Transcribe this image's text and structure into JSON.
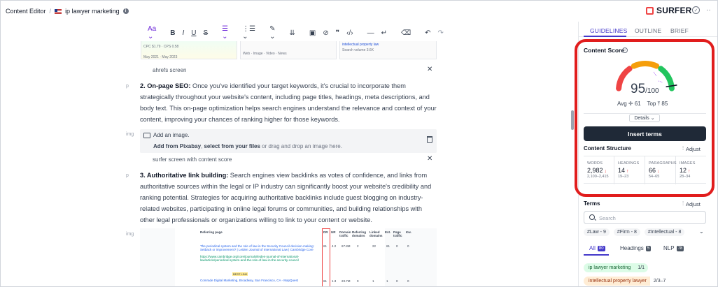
{
  "header": {
    "breadcrumb_root": "Content Editor",
    "breadcrumb_sep": "/",
    "document_name": "ip lawyer marketing",
    "brand": "SURFER"
  },
  "toolbar": {
    "font_label": "Aa"
  },
  "editor": {
    "card1_text": "CPC $1.79 · CPS 0.58",
    "card1_sub": "May 2021 · May 2023",
    "card2_text": "Web · Image · Video · News",
    "card3_link": "intellectual property law",
    "card3_text": "Search volume 3.6K",
    "caption_ahrefs": "ahrefs screen",
    "block_p": "p",
    "block_img": "img",
    "para2_bold": "2. On-page SEO:",
    "para2_text": " Once you've identified your target keywords, it's crucial to incorporate them strategically throughout your website's content, including page titles, headings, meta descriptions, and body text. This on-page optimization helps search engines understand the relevance and context of your content, improving your chances of ranking higher for those keywords.",
    "image_add": "Add an image.",
    "image_from_1": "Add from Pixabay",
    "image_from_2": ", ",
    "image_from_3": "select from your files",
    "image_from_4": " or drag and drop an image here.",
    "caption_surfer": "surfer screen with content score",
    "para3_bold": "3. Authoritative link building:",
    "para3_text": " Search engines view backlinks as votes of confidence, and links from authoritative sources within the legal or IP industry can significantly boost your website's credibility and ranking potential. Strategies for acquiring authoritative backlinks include guest blogging on industry-related websites, participating in online legal forums or communities, and building relationships with other legal professionals or organizations willing to link to your content or website.",
    "table_headers": [
      "Referring page",
      "DR",
      "UR",
      "Domain traffic",
      "Referring domains",
      "Linked domains",
      "Ext.",
      "Page traffic",
      "Kw."
    ],
    "table_row1_title": "The periodical system and the role of law in the Security Council decision-making: Setback or improvement? | Leiden Journal of International Law | Cambridge Core",
    "table_row1_url": "https://www.cambridge.org/core/journals/leiden-journal-of-international-law/article/periodical-system-and-the-role-of-law-in-the-security-council",
    "table_row1_vals": [
      "61",
      "4.2",
      "67.8M",
      "2",
      "22",
      "61",
      "0",
      "0"
    ],
    "table_row1_tag": "BEST LINK",
    "table_row2_title": "Comrade Digital Marketing, Broadway, San Francisco, CA - MapQuest",
    "table_row2_vals": [
      "61",
      "1.3",
      "23.7M",
      "0",
      "1",
      "1",
      "0",
      "0"
    ]
  },
  "sidebar": {
    "tabs": [
      "GUIDELINES",
      "OUTLINE",
      "BRIEF"
    ],
    "content_score_title": "Content Score",
    "score": "95",
    "score_max": "/100",
    "avg_label": "Avg",
    "avg_value": "61",
    "top_label": "Top",
    "top_value": "85",
    "details_label": "Details",
    "insert_terms": "Insert terms",
    "content_structure": "Content Structure",
    "adjust": "Adjust",
    "metrics": [
      {
        "label": "WORDS",
        "value": "2,982",
        "arrow": "↓",
        "range": "2,100–2,415"
      },
      {
        "label": "HEADINGS",
        "value": "14",
        "arrow": "↑",
        "range": "19–23"
      },
      {
        "label": "PARAGRAPHS",
        "value": "66",
        "arrow": "↓",
        "range": "54–65"
      },
      {
        "label": "IMAGES",
        "value": "12",
        "arrow": "↑",
        "range": "28–34"
      }
    ],
    "terms_title": "Terms",
    "search_placeholder": "Search",
    "chips": [
      "#Law - 9",
      "#Firm - 8",
      "#Intellectual - 8"
    ],
    "filters": [
      {
        "label": "All",
        "count": "80"
      },
      {
        "label": "Headings",
        "count": "5"
      },
      {
        "label": "NLP",
        "count": "78"
      }
    ],
    "terms": [
      {
        "name": "ip lawyer marketing",
        "score": "1/1"
      },
      {
        "name": "intellectual property lawyer",
        "score": "2/3–7"
      }
    ],
    "score_fraction": 0.95,
    "gauge_colors": {
      "low": "#ef4444",
      "mid": "#f59e0b",
      "high": "#22c55e"
    }
  }
}
